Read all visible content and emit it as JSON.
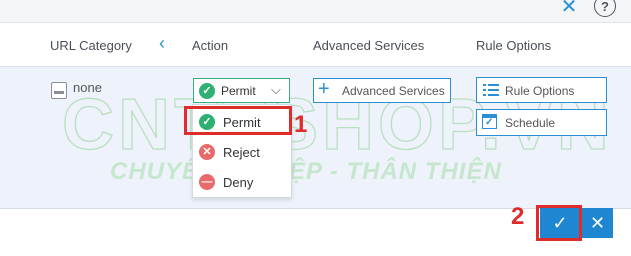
{
  "topbar": {
    "close_glyph": "✕",
    "help_glyph": "?"
  },
  "header": {
    "url_category": "URL Category",
    "collapse_glyph": "‹",
    "action": "Action",
    "advanced_services": "Advanced Services",
    "rule_options": "Rule Options"
  },
  "row": {
    "url_category_value": "none",
    "action_selected": "Permit",
    "action_options": [
      "Permit",
      "Reject",
      "Deny"
    ],
    "advanced_services_button": "Advanced Services",
    "rule_options_button": "Rule Options",
    "schedule_button": "Schedule"
  },
  "annotations": {
    "step1": "1",
    "step2": "2"
  },
  "watermark": {
    "main": "CNTTSHOP.VN",
    "sub": "CHUYÊN NGHIỆP - THÂN THIỆN"
  },
  "footer": {
    "confirm_glyph": "✓",
    "cancel_glyph": "✕"
  },
  "colors": {
    "accent": "#2a8fd6",
    "permit_green": "#2fb073",
    "reject_red": "#e86a6a",
    "highlight_red": "#e02b2b"
  },
  "icons": [
    "close-icon",
    "help-icon",
    "chevron-left-icon",
    "file-icon",
    "check-circle-icon",
    "chevron-down-icon",
    "x-circle-icon",
    "minus-circle-icon",
    "plus-icon",
    "list-icon",
    "calendar-check-icon",
    "check-icon"
  ]
}
